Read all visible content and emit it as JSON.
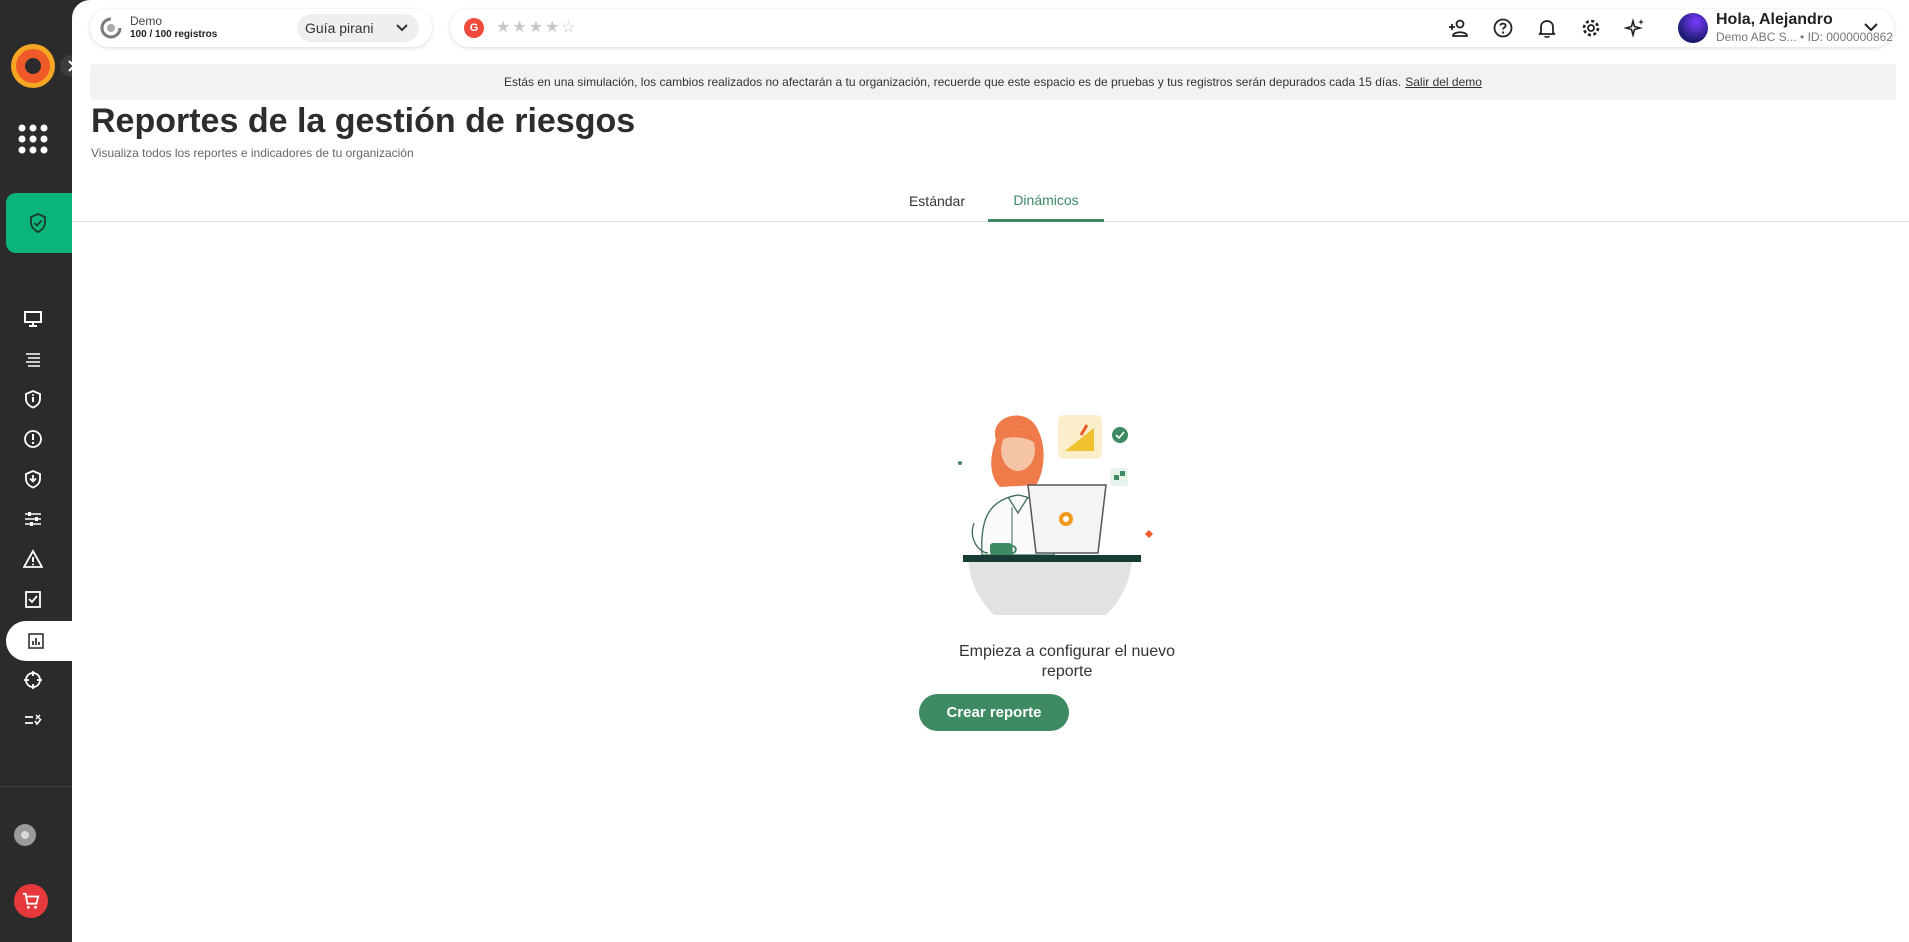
{
  "org": {
    "name": "Demo",
    "records": "100 / 100 registros",
    "guide_label": "Guía pirani"
  },
  "rating": {
    "badge": "G",
    "stars": "★★★★☆"
  },
  "user": {
    "greeting": "Hola, Alejandro",
    "subtitle": "Demo ABC S... • ID: 0000000862"
  },
  "banner": {
    "message": "Estás en una simulación, los cambios realizados no afectarán a tu organización, recuerde que este espacio es de pruebas y tus registros serán depurados cada 15 días.",
    "link": "Salir del demo"
  },
  "page": {
    "title": "Reportes de la gestión de riesgos",
    "subtitle": "Visualiza todos los reportes e indicadores de tu organización"
  },
  "tabs": [
    {
      "label": "Estándar"
    },
    {
      "label": "Dinámicos"
    }
  ],
  "empty_state": {
    "message": "Empieza a configurar el nuevo reporte",
    "button": "Crear reporte"
  },
  "colors": {
    "accent": "#3d8a63",
    "module_green": "#0bb47a",
    "sidebar_bg": "#2b2b2b",
    "cart_red": "#e5393c"
  },
  "sidebar": {
    "icons": [
      "monitor-icon",
      "list-icon",
      "shield-info-icon",
      "alert-circle-icon",
      "shield-download-icon",
      "sliders-icon",
      "warning-triangle-icon",
      "checklist-icon",
      "bar-chart-icon",
      "crosshair-icon",
      "list-check-icon"
    ]
  }
}
